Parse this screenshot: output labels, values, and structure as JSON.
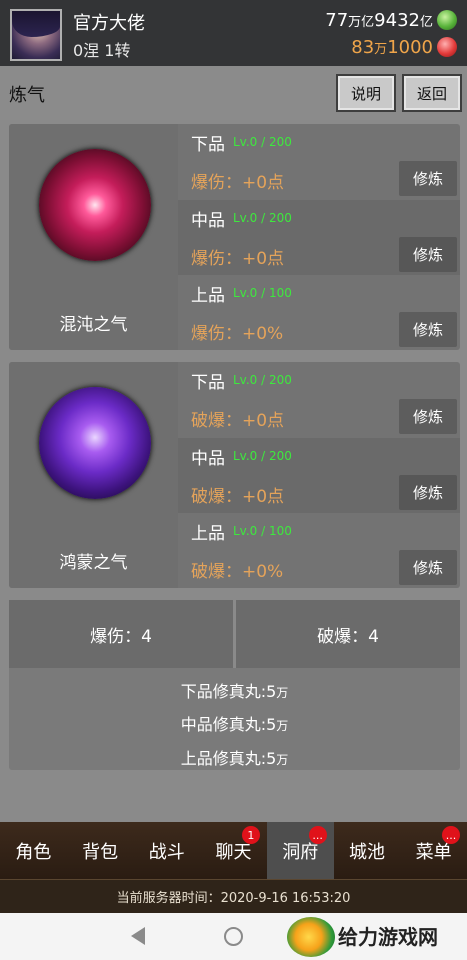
{
  "header": {
    "player_name": "官方大佬",
    "player_rank": "0涅 1转",
    "currency1": {
      "amount_a": "77",
      "unit_a": "万亿",
      "amount_b": "9432",
      "unit_b": "亿"
    },
    "currency2": {
      "amount_a": "83",
      "unit_a": "万",
      "amount_b": "1000"
    }
  },
  "titlebar": {
    "title": "炼气",
    "help_label": "说明",
    "back_label": "返回"
  },
  "panels": [
    {
      "name": "混沌之气",
      "rows": [
        {
          "grade": "下品",
          "level": "Lv.0 / 200",
          "stat": "爆伤：+0点",
          "button": "修炼"
        },
        {
          "grade": "中品",
          "level": "Lv.0 / 200",
          "stat": "爆伤：+0点",
          "button": "修炼"
        },
        {
          "grade": "上品",
          "level": "Lv.0 / 100",
          "stat": "爆伤：+0%",
          "button": "修炼"
        }
      ]
    },
    {
      "name": "鸿蒙之气",
      "rows": [
        {
          "grade": "下品",
          "level": "Lv.0 / 200",
          "stat": "破爆：+0点",
          "button": "修炼"
        },
        {
          "grade": "中品",
          "level": "Lv.0 / 200",
          "stat": "破爆：+0点",
          "button": "修炼"
        },
        {
          "grade": "上品",
          "level": "Lv.0 / 100",
          "stat": "破爆：+0%",
          "button": "修炼"
        }
      ]
    }
  ],
  "summary": {
    "crit_damage": "爆伤：4",
    "crit_break": "破爆：4"
  },
  "pills": [
    {
      "label": "下品修真丸:5",
      "unit": "万"
    },
    {
      "label": "中品修真丸:5",
      "unit": "万"
    },
    {
      "label": "上品修真丸:5",
      "unit": "万"
    }
  ],
  "nav": {
    "items": [
      {
        "label": "角色",
        "badge": ""
      },
      {
        "label": "背包",
        "badge": ""
      },
      {
        "label": "战斗",
        "badge": ""
      },
      {
        "label": "聊天",
        "badge": "1"
      },
      {
        "label": "洞府",
        "badge": "..."
      },
      {
        "label": "城池",
        "badge": ""
      },
      {
        "label": "菜单",
        "badge": "..."
      }
    ],
    "active_index": 4
  },
  "server_time": "当前服务器时间：2020-9-16 16:53:20",
  "watermark": "给力游戏网",
  "colors": {
    "level_green": "#3ee83e",
    "stat_orange": "#e4a35a",
    "badge_red": "#e0121a",
    "currency2": "#f0a54a"
  }
}
